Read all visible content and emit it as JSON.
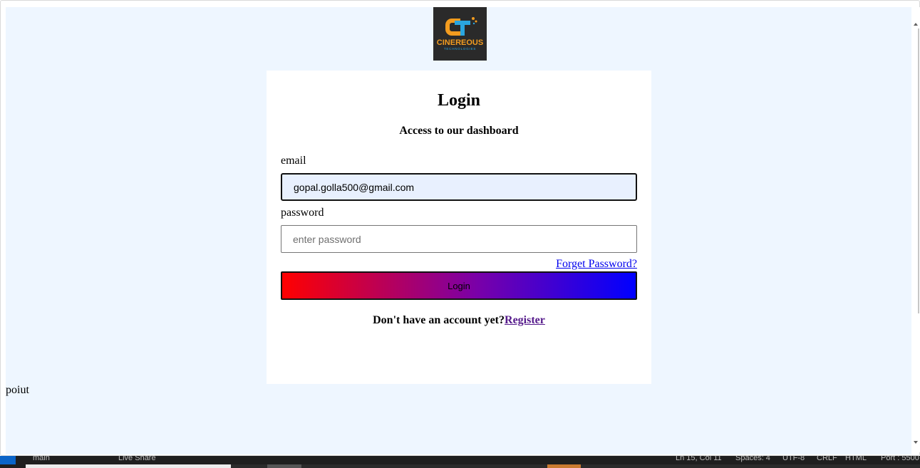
{
  "logo": {
    "name": "CINEREOUS",
    "tagline": "TECHNOLOGIES",
    "monogram": "CT",
    "accent_orange": "#f39c1f",
    "accent_blue": "#2aa6e0"
  },
  "login_card": {
    "title": "Login",
    "subtitle": "Access to our dashboard",
    "email_label": "email",
    "email_value": "gopal.golla500@gmail.com",
    "password_label": "password",
    "password_placeholder": "enter password",
    "forgot_link": "Forget Password?",
    "login_button": "Login",
    "register_prompt": "Don't have an account yet?",
    "register_link": "Register"
  },
  "stray_text": "poiut",
  "taskbar": {
    "branch": "main",
    "liveshare": "Live Share",
    "position": "Ln 15, Col 11",
    "spaces": "Spaces: 4",
    "encoding": "UTF-8",
    "eol": "CRLF",
    "language": "HTML",
    "port": "Port : 5500"
  },
  "colors": {
    "page_background": "#eef6ff",
    "gradient_start": "#ff0000",
    "gradient_end": "#0000ff",
    "link": "#0000ee",
    "visited_link": "#551a8b"
  }
}
